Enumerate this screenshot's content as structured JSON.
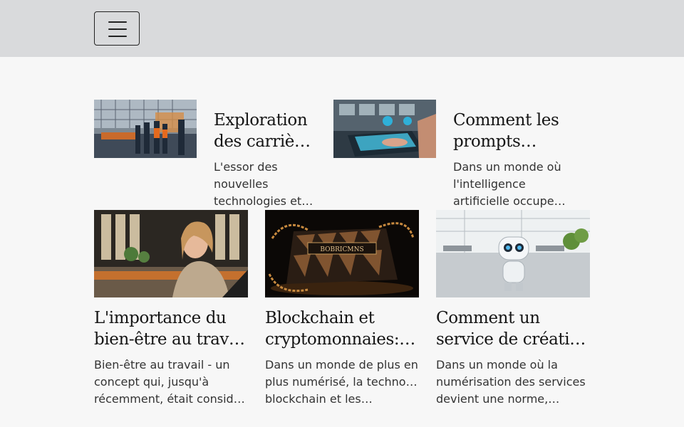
{
  "header": {
    "menu_icon": "hamburger-menu-icon",
    "background": "#d9dadc"
  },
  "featured": [
    {
      "image": "workers-in-factory-image",
      "title_lines": [
        "Exploration",
        "des carrière…"
      ],
      "excerpt_lines": [
        "L'essor des",
        "nouvelles",
        "technologies et…"
      ]
    },
    {
      "image": "laptop-hands-image",
      "title_lines": [
        "Comment les",
        "prompts…"
      ],
      "excerpt_lines": [
        "Dans un monde où",
        "l'intelligence",
        "artificielle occupe…"
      ]
    }
  ],
  "articles": [
    {
      "image": "smiling-woman-office-image",
      "title_lines": [
        "L'importance du",
        "bien-être au travai…"
      ],
      "excerpt_lines": [
        "Bien-être au travail - un",
        "concept qui, jusqu'à",
        "récemment, était considéré…"
      ]
    },
    {
      "image": "crypto-chain-object-image",
      "image_text": "BOBRICMNS",
      "title_lines": [
        "Blockchain et",
        "cryptomonnaies: u…"
      ],
      "excerpt_lines": [
        "Dans un monde de plus en",
        "plus numérisé, la technologie",
        "blockchain et les…"
      ]
    },
    {
      "image": "robot-office-image",
      "title_lines": [
        "Comment un",
        "service de création…"
      ],
      "excerpt_lines": [
        "Dans un monde où la",
        "numérisation des services",
        "devient une norme,…"
      ]
    }
  ]
}
